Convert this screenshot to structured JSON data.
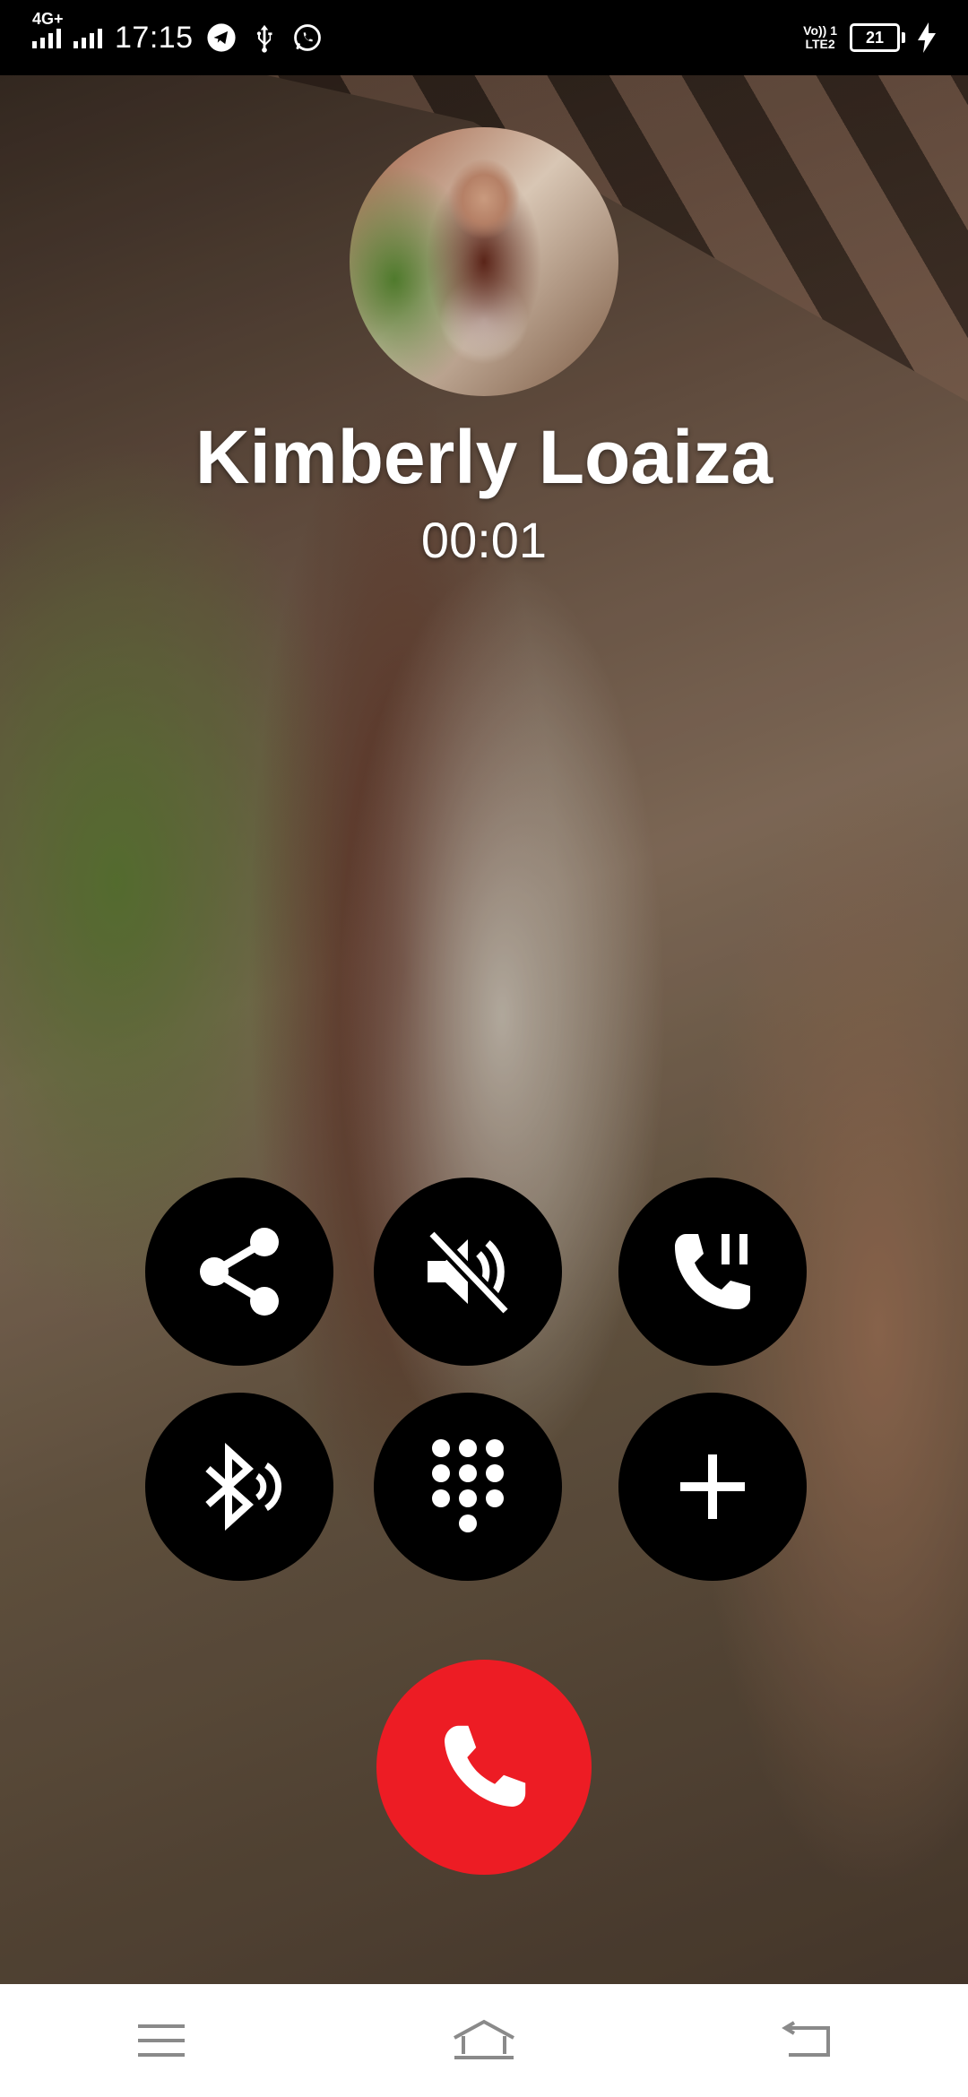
{
  "status_bar": {
    "network": "4G+",
    "time": "17:15",
    "volte_line1": "Vo)) 1",
    "volte_line2": "LTE2",
    "battery": "21",
    "icons": [
      "signal-icon",
      "signal-icon",
      "telegram-icon",
      "usb-icon",
      "whatsapp-icon",
      "volte-icon",
      "battery-icon",
      "charging-icon"
    ]
  },
  "call": {
    "caller_name": "Kimberly Loaiza",
    "timer": "00:01"
  },
  "controls": [
    {
      "icon": "share-icon"
    },
    {
      "icon": "mute-speaker-icon"
    },
    {
      "icon": "call-hold-icon"
    },
    {
      "icon": "bluetooth-audio-icon"
    },
    {
      "icon": "dialpad-icon"
    },
    {
      "icon": "add-call-icon"
    }
  ],
  "end_call": {
    "icon": "phone-icon",
    "color": "#ed1c24"
  },
  "nav": {
    "icons": [
      "menu-icon",
      "home-icon",
      "back-icon"
    ]
  }
}
